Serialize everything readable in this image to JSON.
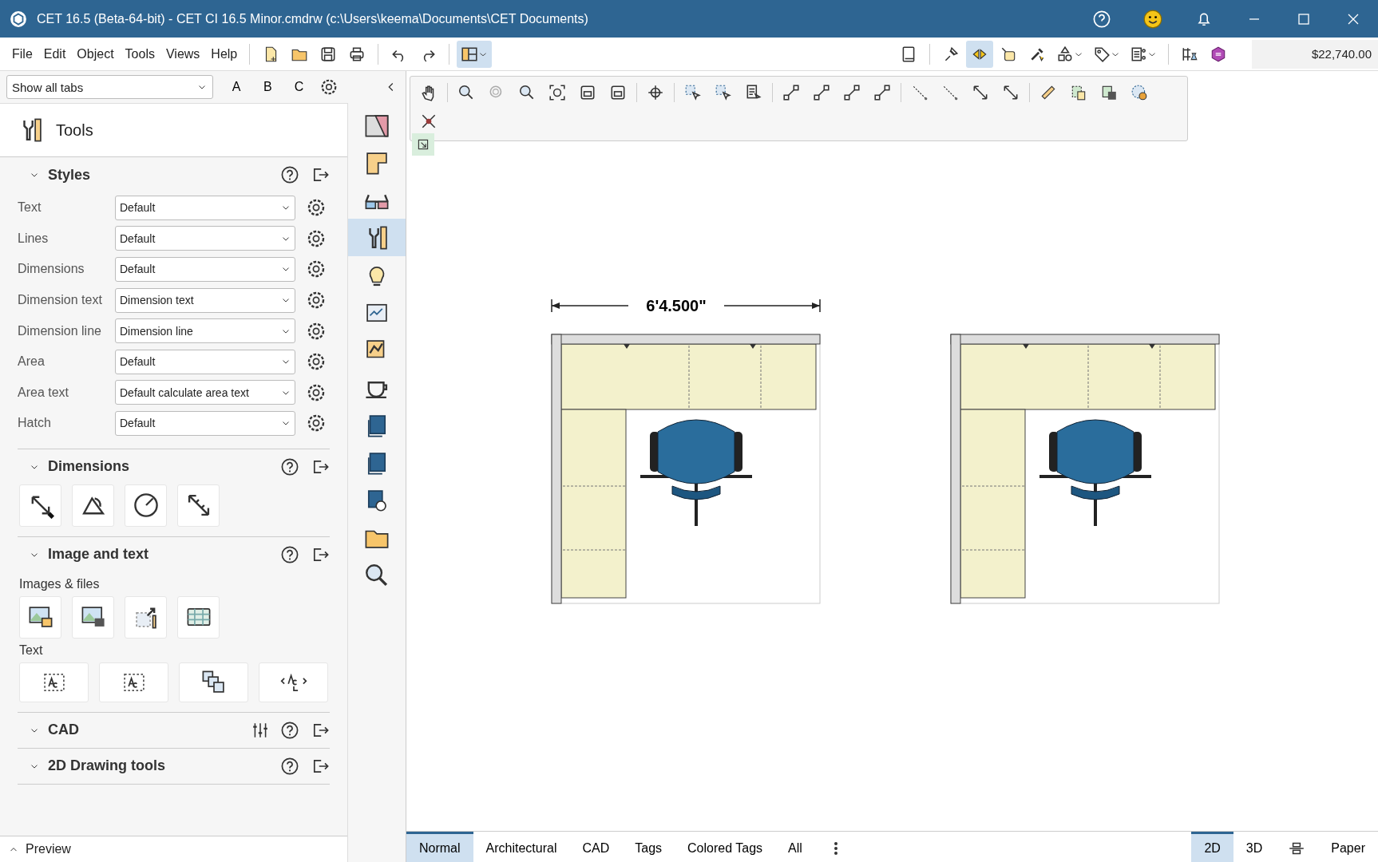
{
  "window": {
    "title": "CET 16.5 (Beta-64-bit) - CET CI 16.5 Minor.cmdrw (c:\\Users\\keema\\Documents\\CET Documents)"
  },
  "menu": [
    "File",
    "Edit",
    "Object",
    "Tools",
    "Views",
    "Help"
  ],
  "toolbar": [
    {
      "selected": false
    },
    {
      "selected": false
    },
    {
      "selected": false
    },
    {
      "selected": false
    },
    {
      "selected": false
    },
    {
      "selected": false
    },
    {
      "selected": true
    }
  ],
  "toolbar_right": [
    {
      "selected": false
    },
    {
      "selected": false
    },
    {
      "selected": true
    },
    {
      "selected": false
    },
    {
      "selected": false
    },
    {
      "selected": false
    },
    {
      "selected": false
    },
    {
      "selected": false
    },
    {
      "selected": false
    },
    {
      "selected": false
    }
  ],
  "price": "$22,740.00",
  "tab_filter": {
    "value": "Show all tabs",
    "buttons": [
      "A",
      "B",
      "C"
    ]
  },
  "panel": {
    "title": "Tools",
    "sections": [
      {
        "title": "Styles",
        "kind": "styles",
        "rows": [
          {
            "label": "Text",
            "value": "Default"
          },
          {
            "label": "Lines",
            "value": "Default"
          },
          {
            "label": "Dimensions",
            "value": "Default"
          },
          {
            "label": "Dimension text",
            "value": "Dimension text"
          },
          {
            "label": "Dimension line",
            "value": "Dimension line"
          },
          {
            "label": "Area",
            "value": "Default"
          },
          {
            "label": "Area text",
            "value": "Default calculate area text"
          },
          {
            "label": "Hatch",
            "value": "Default"
          }
        ]
      },
      {
        "title": "Dimensions",
        "kind": "tools",
        "groups": [
          {
            "kind": "dimension_tools"
          }
        ]
      },
      {
        "title": "Image and text",
        "kind": "tools",
        "groups": [
          {
            "label": "Images & files",
            "kind": "image_tools"
          },
          {
            "label": "Text",
            "kind": "text_tools"
          }
        ]
      },
      {
        "title": "CAD",
        "kind": "settings"
      },
      {
        "title": "2D Drawing tools",
        "kind": "plain"
      }
    ]
  },
  "preview": {
    "label": "Preview"
  },
  "side_tabs": [
    {
      "selected": false
    },
    {
      "selected": false
    },
    {
      "selected": false
    },
    {
      "selected": true
    },
    {
      "selected": false
    },
    {
      "selected": false
    },
    {
      "selected": false
    },
    {
      "selected": false
    },
    {
      "selected": false
    },
    {
      "selected": false
    },
    {
      "selected": false
    },
    {
      "selected": false
    },
    {
      "selected": false
    }
  ],
  "drawing": {
    "dimension": "6'4.500\""
  },
  "view_tabs": [
    {
      "label": "Normal",
      "selected": true
    },
    {
      "label": "Architectural",
      "selected": false
    },
    {
      "label": "CAD",
      "selected": false
    },
    {
      "label": "Tags",
      "selected": false
    },
    {
      "label": "Colored Tags",
      "selected": false
    },
    {
      "label": "All",
      "selected": false
    }
  ],
  "view_modes": [
    {
      "kind": "text",
      "label": "2D",
      "selected": true
    },
    {
      "kind": "text",
      "label": "3D",
      "selected": false
    },
    {
      "kind": "icon",
      "selected": false
    },
    {
      "kind": "text",
      "label": "Paper",
      "selected": false
    }
  ]
}
